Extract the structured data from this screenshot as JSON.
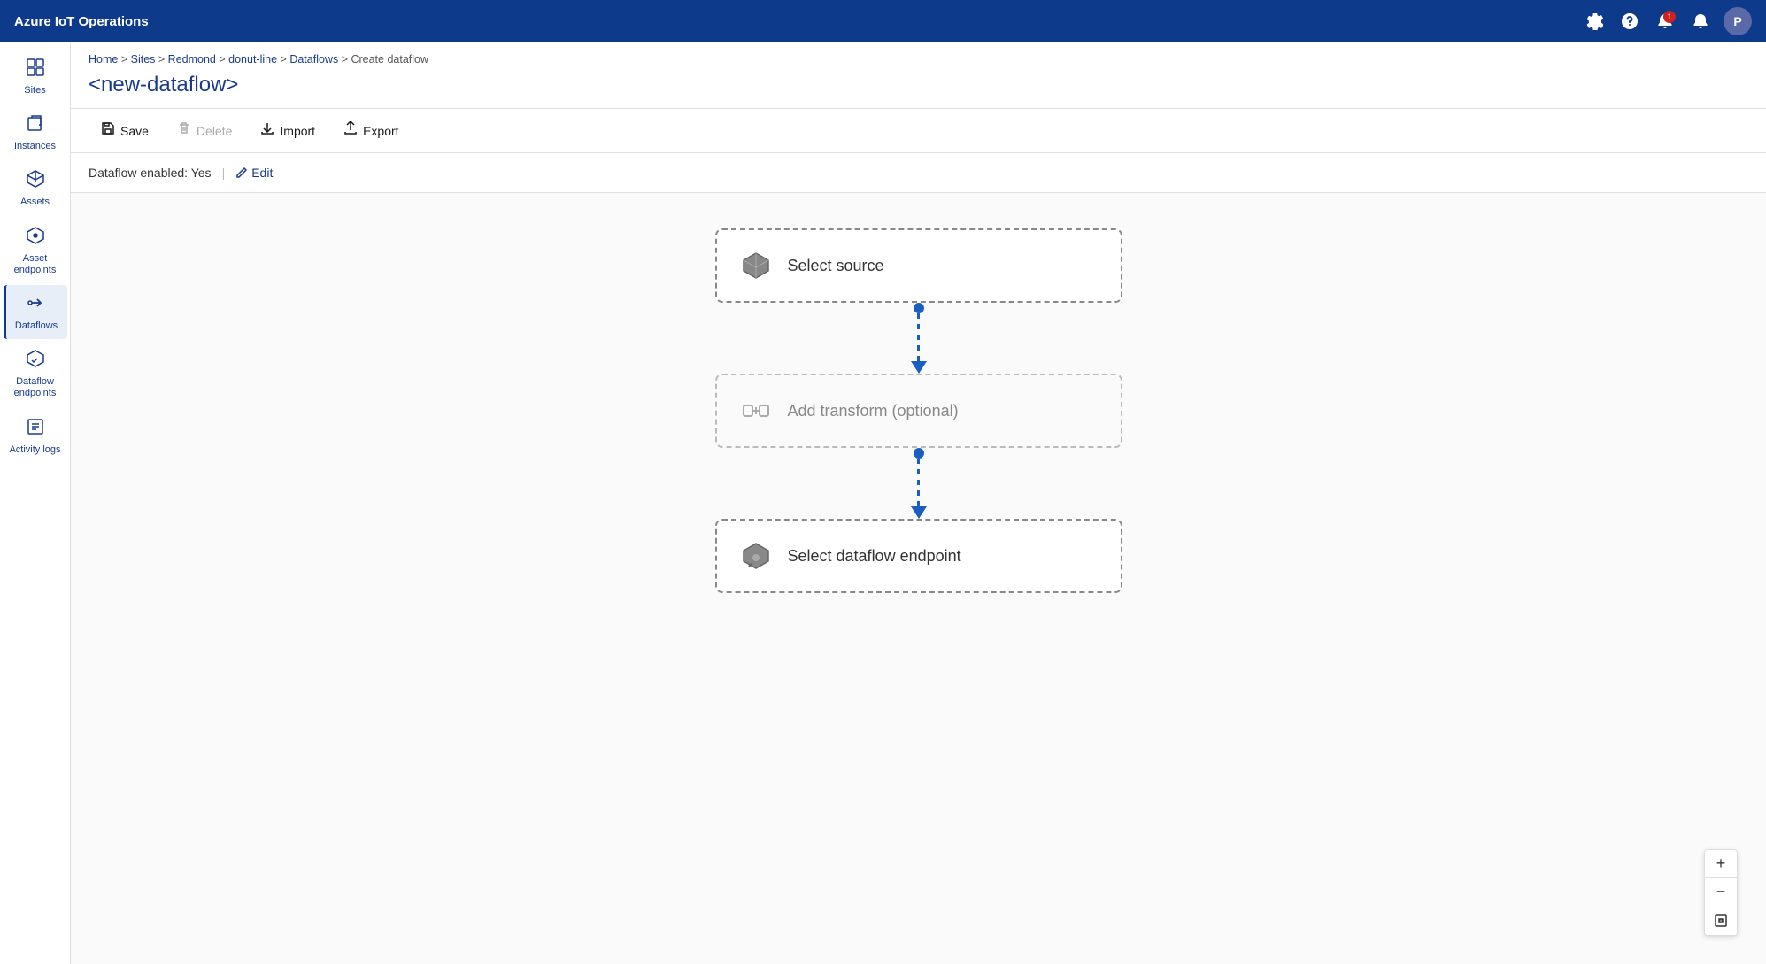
{
  "app": {
    "title": "Azure IoT Operations"
  },
  "topnav": {
    "title": "Azure IoT Operations",
    "avatar_label": "P",
    "notification_count": "1"
  },
  "breadcrumb": {
    "items": [
      "Home",
      "Sites",
      "Redmond",
      "donut-line",
      "Dataflows",
      "Create dataflow"
    ],
    "separators": [
      ">",
      ">",
      ">",
      ">",
      ">"
    ]
  },
  "page": {
    "title": "<new-dataflow>"
  },
  "toolbar": {
    "save_label": "Save",
    "delete_label": "Delete",
    "import_label": "Import",
    "export_label": "Export"
  },
  "status": {
    "label": "Dataflow enabled: Yes",
    "edit_label": "Edit"
  },
  "flow": {
    "source_label": "Select source",
    "transform_label": "Add transform (optional)",
    "endpoint_label": "Select dataflow endpoint"
  },
  "zoom": {
    "plus": "+",
    "minus": "−"
  },
  "sidebar": {
    "items": [
      {
        "id": "sites",
        "label": "Sites",
        "icon": "⊞"
      },
      {
        "id": "instances",
        "label": "Instances",
        "icon": "❏"
      },
      {
        "id": "assets",
        "label": "Assets",
        "icon": "◈"
      },
      {
        "id": "asset-endpoints",
        "label": "Asset endpoints",
        "icon": "⬡"
      },
      {
        "id": "dataflows",
        "label": "Dataflows",
        "icon": "⇄"
      },
      {
        "id": "dataflow-endpoints",
        "label": "Dataflow endpoints",
        "icon": "⬡"
      },
      {
        "id": "activity-logs",
        "label": "Activity logs",
        "icon": "≡"
      }
    ]
  }
}
